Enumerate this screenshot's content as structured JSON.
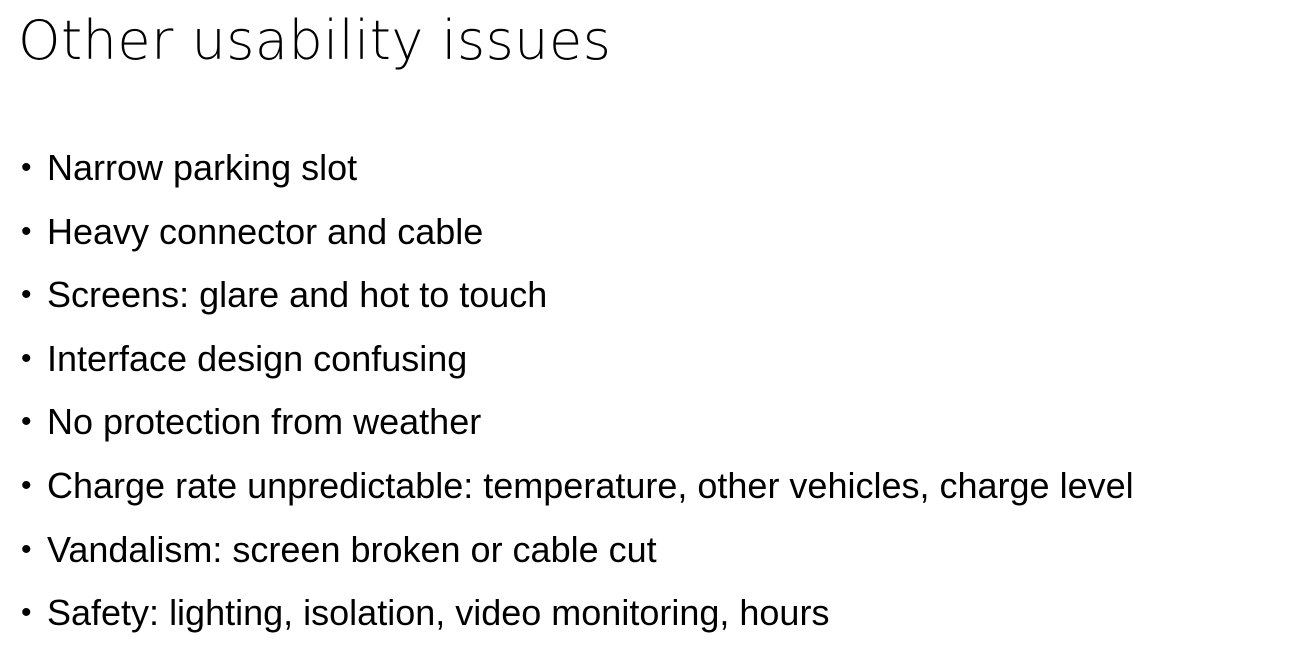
{
  "slide": {
    "title": "Other usability issues",
    "bullets": [
      "Narrow parking slot",
      "Heavy connector and cable",
      "Screens: glare and hot to touch",
      "Interface design confusing",
      "No protection from weather",
      "Charge rate unpredictable: temperature, other vehicles, charge level",
      "Vandalism: screen broken or cable cut",
      "Safety: lighting, isolation, video monitoring, hours"
    ]
  }
}
